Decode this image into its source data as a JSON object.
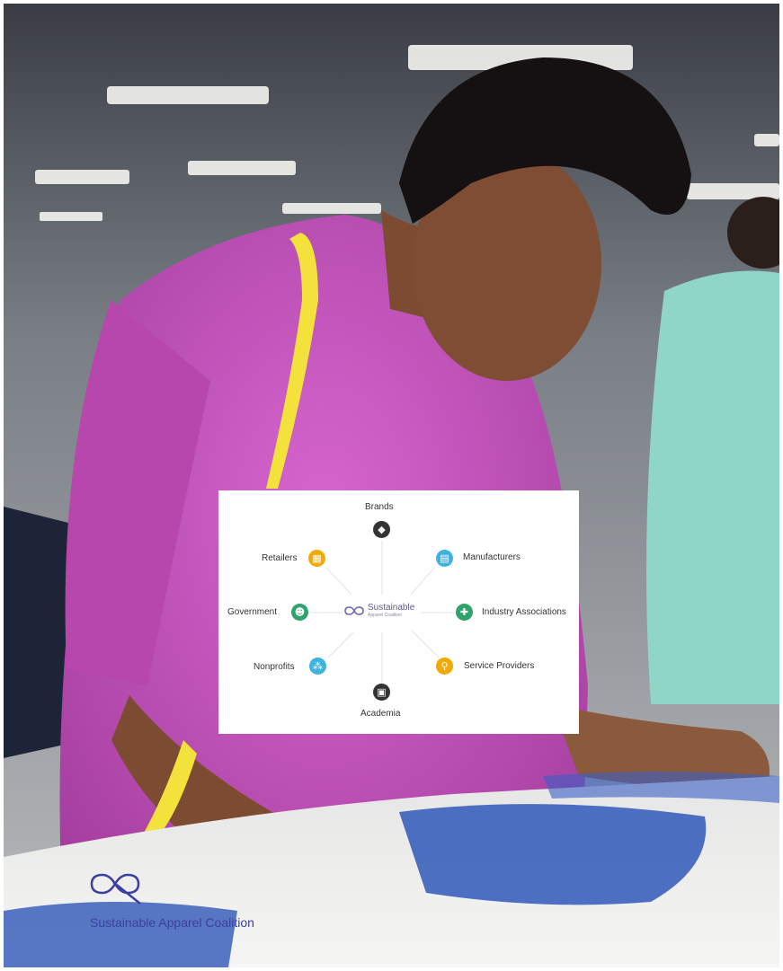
{
  "diagram": {
    "center": {
      "name": "Sustainable",
      "sub": "Apparel Coalition"
    },
    "nodes": {
      "brands": {
        "label": "Brands",
        "color": "#333333",
        "icon": "tag-icon"
      },
      "manufacturers": {
        "label": "Manufacturers",
        "color": "#3fb3e0",
        "icon": "factory-icon"
      },
      "industry": {
        "label": "Industry Associations",
        "color": "#2fa36b",
        "icon": "handshake-icon"
      },
      "service": {
        "label": "Service Providers",
        "color": "#f2a900",
        "icon": "magnifier-icon"
      },
      "academia": {
        "label": "Academia",
        "color": "#333333",
        "icon": "book-icon"
      },
      "nonprofits": {
        "label": "Nonprofits",
        "color": "#3fb3e0",
        "icon": "people-icon"
      },
      "government": {
        "label": "Government",
        "color": "#2fa36b",
        "icon": "person-icon"
      },
      "retailers": {
        "label": "Retailers",
        "color": "#f2a900",
        "icon": "store-icon"
      }
    }
  },
  "footer": {
    "brand_name": "Sustainable Apparel Coalition",
    "brand_color": "#3d3fa0"
  },
  "photo": {
    "description_colors": {
      "shirt": "#c54fc0",
      "background": "#7d8188"
    }
  }
}
